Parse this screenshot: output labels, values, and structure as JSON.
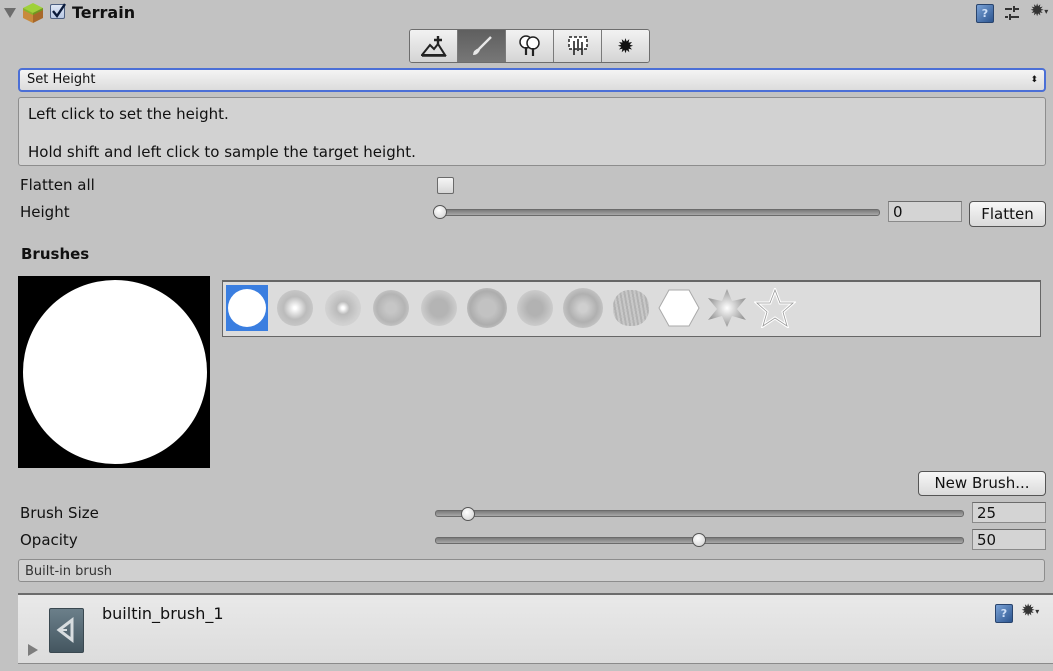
{
  "header": {
    "title": "Terrain",
    "enabled": true,
    "icons": [
      "foldout-arrow-icon",
      "terrain-cube-icon",
      "help-book-icon",
      "preset-sliders-icon",
      "settings-gear-icon"
    ]
  },
  "toolbar": {
    "tools": [
      {
        "name": "raise-lower-terrain",
        "icon": "mountain-plus-icon",
        "active": false
      },
      {
        "name": "paint-height",
        "icon": "paintbrush-icon",
        "active": true
      },
      {
        "name": "place-trees",
        "icon": "trees-icon",
        "active": false
      },
      {
        "name": "paint-details",
        "icon": "grass-details-icon",
        "active": false
      },
      {
        "name": "terrain-settings",
        "icon": "gear-icon",
        "active": false
      }
    ]
  },
  "mode_dropdown": {
    "selected": "Set Height"
  },
  "help": {
    "line1": "Left click to set the height.",
    "line2": "Hold shift and left click to sample the target height."
  },
  "flatten_all": {
    "label": "Flatten all",
    "checked": false
  },
  "height": {
    "label": "Height",
    "value": "0",
    "slider_fraction": 0.0,
    "button": "Flatten"
  },
  "brushes": {
    "heading": "Brushes",
    "selected_index": 0,
    "items": [
      "hard-circle",
      "soft-circle",
      "small-soft-circle",
      "noisy-circle",
      "speckle",
      "noise-blob",
      "spotted",
      "cloud-blob",
      "streaks",
      "hexagon",
      "soft-star",
      "star-outline"
    ],
    "new_brush_label": "New Brush..."
  },
  "brush_size": {
    "label": "Brush Size",
    "value": "25",
    "slider_fraction": 0.06
  },
  "opacity": {
    "label": "Opacity",
    "value": "50",
    "slider_fraction": 0.5
  },
  "builtin_label": "Built-in brush",
  "asset": {
    "name": "builtin_brush_1"
  }
}
